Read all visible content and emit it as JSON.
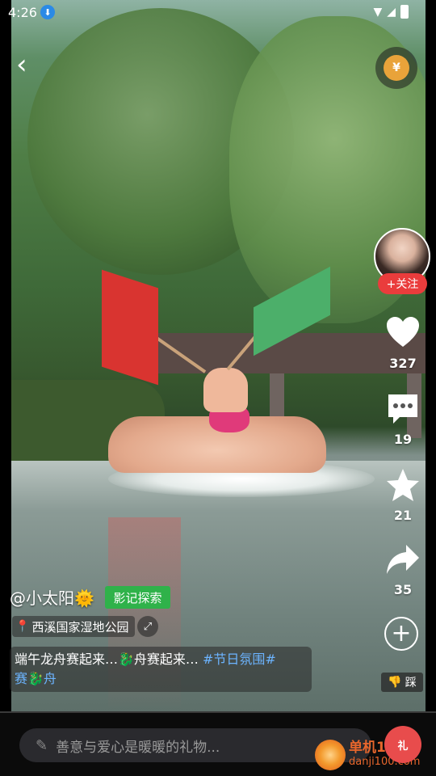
{
  "status_bar": {
    "time": "4:26"
  },
  "colors": {
    "follow": "#ea3c3c",
    "explore": "#2fb24a",
    "hashtag": "#6cb4ff",
    "background": "#000000"
  },
  "video": {
    "description_icons": [
      "back-icon",
      "money-bag-icon"
    ]
  },
  "author": {
    "follow_label": "+关注",
    "username": "@小太阳🌞",
    "explore_label": "影记探索",
    "location": "西溪国家湿地公园"
  },
  "rail": {
    "likes": "327",
    "comments": "19",
    "favorites": "21",
    "shares": "35"
  },
  "caption": {
    "text": "端午龙舟赛起来…🐉舟赛起来… ",
    "tag1": "#节日氛围#",
    "tag2_prefix": "赛🐉舟"
  },
  "dislike_label": "踩",
  "comment_bar": {
    "placeholder": "善意与爱心是暖暖的礼物..."
  },
  "watermark": {
    "name": "单机100网",
    "url": "danji100.com"
  }
}
